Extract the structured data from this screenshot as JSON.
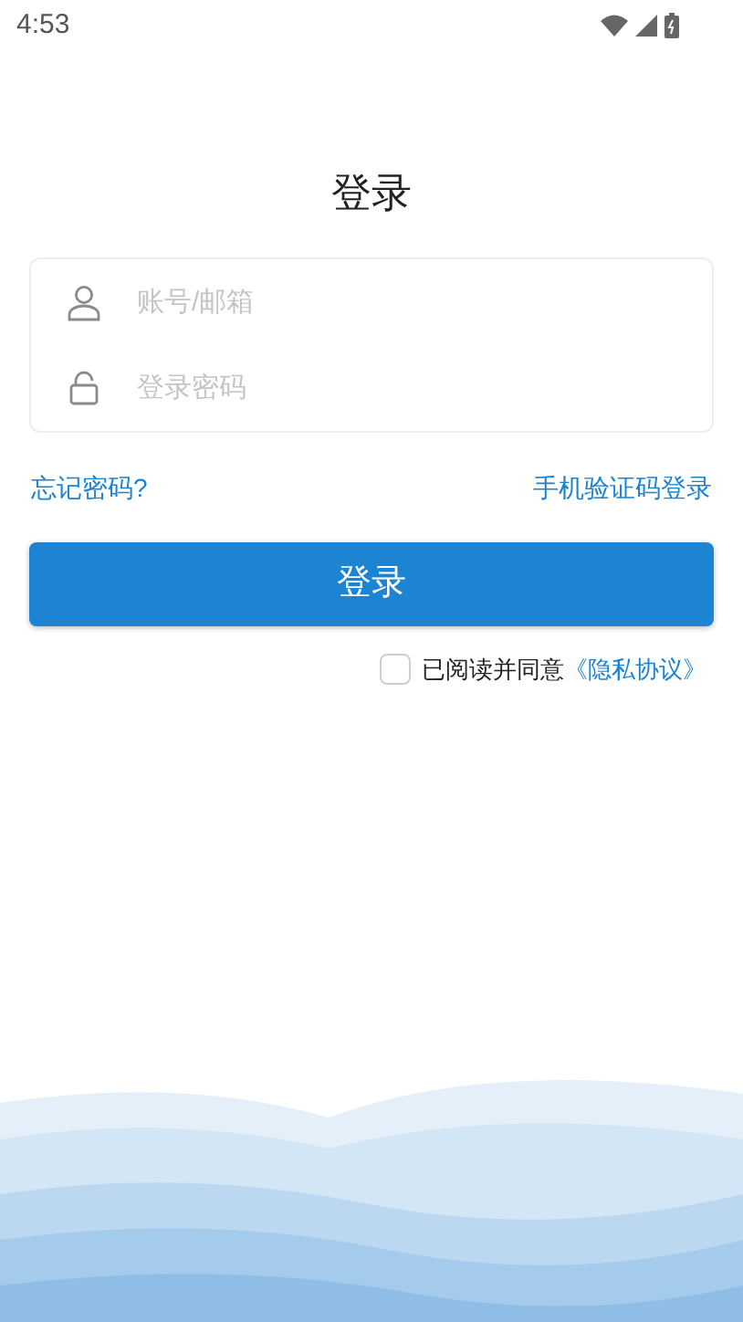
{
  "status_bar": {
    "time": "4:53"
  },
  "title": "登录",
  "fields": [
    {
      "kind": "account",
      "placeholder": "账号/邮箱"
    },
    {
      "kind": "password",
      "placeholder": "登录密码"
    }
  ],
  "links": {
    "forgot": "忘记密码?",
    "sms_login": "手机验证码登录"
  },
  "login_button": "登录",
  "agreement": {
    "checked": false,
    "text": "已阅读并同意",
    "link": "《隐私协议》"
  }
}
